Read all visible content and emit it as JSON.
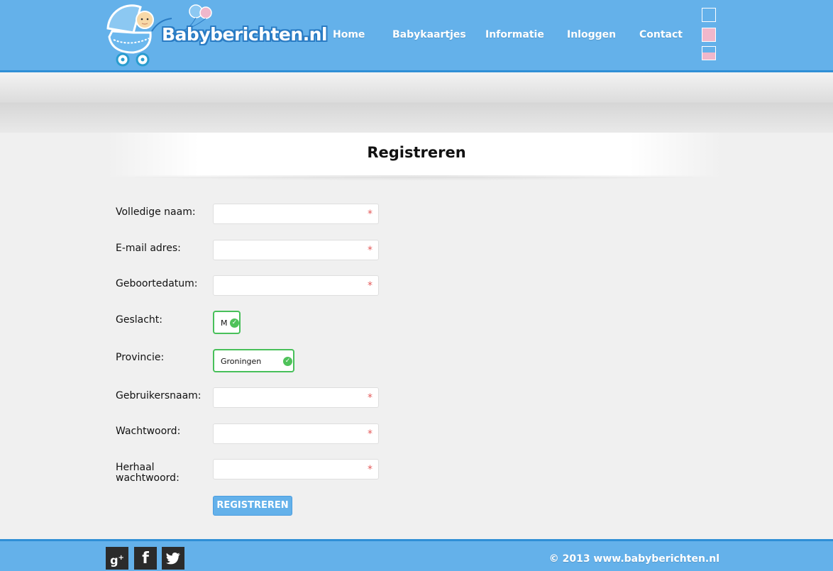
{
  "header": {
    "logo_text": "Babyberichten.nl",
    "nav": [
      "Home",
      "Babykaartjes",
      "Informatie",
      "Inloggen",
      "Contact"
    ],
    "theme_swatches": [
      "#64b1ea",
      "#f0b7cb",
      "blue-pink"
    ]
  },
  "page": {
    "title": "Registreren"
  },
  "form": {
    "full_name_label": "Volledige naam:",
    "email_label": "E-mail adres:",
    "birthdate_label": "Geboortedatum:",
    "gender_label": "Geslacht:",
    "gender_value": "M",
    "province_label": "Provincie:",
    "province_value": "Groningen",
    "username_label": "Gebruikersnaam:",
    "password_label": "Wachtwoord:",
    "repeat_password_label_1": "Herhaal",
    "repeat_password_label_2": "wachtwoord:",
    "required_marker": "*",
    "submit_label": "REGISTREREN"
  },
  "footer": {
    "copyright": "© 2013 www.babyberichten.nl",
    "social": [
      "google-plus-icon",
      "facebook-icon",
      "twitter-icon"
    ]
  }
}
